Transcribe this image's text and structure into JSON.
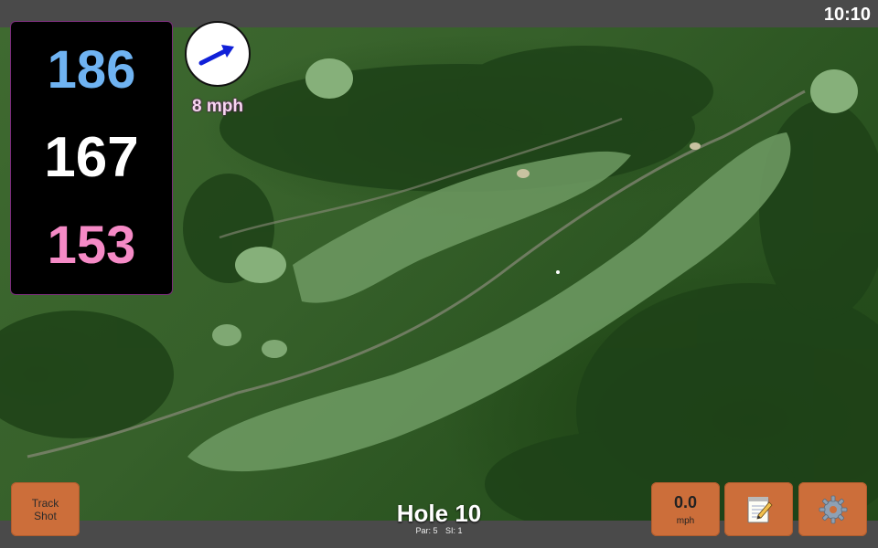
{
  "status": {
    "time": "10:10"
  },
  "distances": {
    "front": "186",
    "middle": "167",
    "back": "153"
  },
  "wind": {
    "speed": "8 mph",
    "arrow_color": "#1020d8"
  },
  "buttons": {
    "track_line1": "Track",
    "track_line2": "Shot",
    "speed_value": "0.0",
    "speed_unit": "mph",
    "notes_icon": "notepad-icon",
    "settings_icon": "gear-icon"
  },
  "hole": {
    "title": "Hole 10",
    "par": "Par: 5",
    "si": "SI: 1"
  },
  "colors": {
    "button": "#cc6e3a",
    "front": "#6fb3f2",
    "back": "#f58ac6",
    "panel_border": "#7a2d7a"
  }
}
